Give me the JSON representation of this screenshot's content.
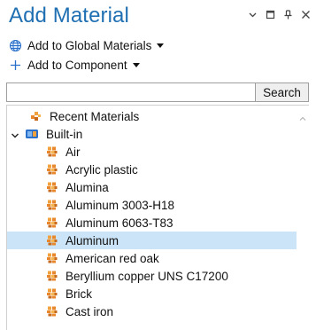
{
  "header": {
    "title": "Add Material"
  },
  "actions": {
    "global_label": "Add to Global Materials",
    "component_label": "Add to Component"
  },
  "search": {
    "value": "",
    "placeholder": "",
    "button_label": "Search"
  },
  "tree": {
    "recent_label": "Recent Materials",
    "builtin_label": "Built-in",
    "items": [
      {
        "label": "Air",
        "selected": false
      },
      {
        "label": "Acrylic plastic",
        "selected": false
      },
      {
        "label": "Alumina",
        "selected": false
      },
      {
        "label": "Aluminum 3003-H18",
        "selected": false
      },
      {
        "label": "Aluminum 6063-T83",
        "selected": false
      },
      {
        "label": "Aluminum",
        "selected": true
      },
      {
        "label": "American red oak",
        "selected": false
      },
      {
        "label": "Beryllium copper UNS C17200",
        "selected": false
      },
      {
        "label": "Brick",
        "selected": false
      },
      {
        "label": "Cast iron",
        "selected": false
      }
    ]
  },
  "colors": {
    "title": "#1f6fb2",
    "selection": "#cce4f7",
    "material_icon": "#e8872b",
    "builtin_icon": "#2a6fc9"
  },
  "icons": {
    "window": [
      "chevron-down-icon",
      "maximize-icon",
      "pin-icon",
      "close-icon"
    ],
    "global": "globe-add-icon",
    "component": "plus-icon",
    "recent": "recent-materials-icon",
    "builtin": "builtin-library-icon",
    "material": "material-icon"
  }
}
